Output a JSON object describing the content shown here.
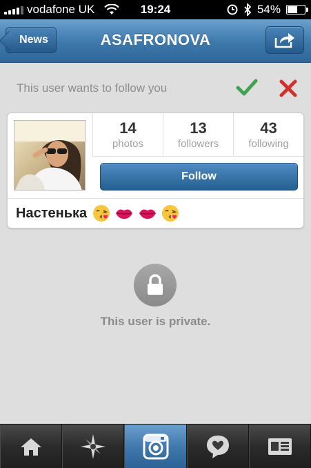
{
  "status_bar": {
    "carrier": "vodafone UK",
    "time": "19:24",
    "battery_percent_label": "54%",
    "battery_level": 0.54
  },
  "nav": {
    "back_label": "News",
    "title": "ASAFRONOVA",
    "share_icon": "share-icon"
  },
  "follow_request": {
    "text": "This user wants to follow you",
    "accept_color": "#3fa34d",
    "reject_color": "#d0312d"
  },
  "profile": {
    "stats": [
      {
        "value": "14",
        "label": "photos"
      },
      {
        "value": "13",
        "label": "followers"
      },
      {
        "value": "43",
        "label": "following"
      }
    ],
    "follow_label": "Follow",
    "display_name": "Настенька",
    "emojis": [
      "kiss-face",
      "lips",
      "lips",
      "kiss-face"
    ]
  },
  "private": {
    "text": "This user is private.",
    "icon": "lock-icon"
  },
  "tabs": [
    {
      "icon": "home-icon",
      "active": false
    },
    {
      "icon": "explore-icon",
      "active": false
    },
    {
      "icon": "camera-icon",
      "active": true
    },
    {
      "icon": "activity-icon",
      "active": false
    },
    {
      "icon": "profile-icon",
      "active": false
    }
  ]
}
